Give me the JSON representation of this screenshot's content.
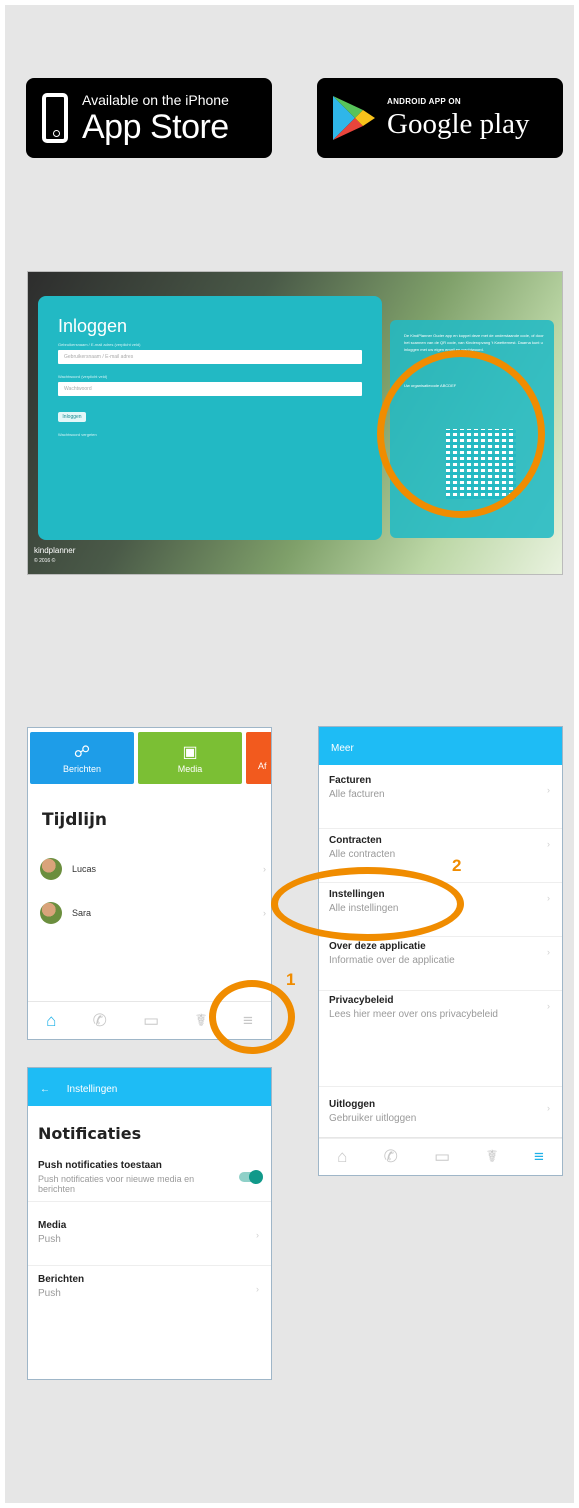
{
  "badges": {
    "apple": {
      "small": "Available on the iPhone",
      "big": "App Store"
    },
    "google": {
      "small": "ANDROID APP ON",
      "big": "Google play"
    }
  },
  "login": {
    "title": "Inloggen",
    "username_label": "Gebruikersnaam / E-mail adres (verplicht veld)",
    "username_placeholder": "Gebruikersnaam / E-mail adres",
    "password_label": "Wachtwoord (verplicht veld)",
    "password_placeholder": "Wachtwoord",
    "login_button": "Inloggen",
    "forgot": "Wachtwoord vergeten",
    "side_text": "De KindPlanner Ouder app en koppel deze met de onderstaande code, of door het scannen van de QR code, van Kinderopvang 't Kwetternest. Daarna kunt u inloggen met uw eigen email en wachtwoord.",
    "org_label": "Uw organisatiecode ABCDEF",
    "brand": "kindplanner",
    "copyright": "© 2016 ©"
  },
  "timeline": {
    "tiles": [
      {
        "label": "Berichten",
        "icon": "☍"
      },
      {
        "label": "Media",
        "icon": "▣"
      },
      {
        "label": "Af"
      }
    ],
    "heading": "Tijdlijn",
    "kids": [
      {
        "name": "Lucas"
      },
      {
        "name": "Sara"
      }
    ],
    "tab_icons": [
      "⌂",
      "✆",
      "▭",
      "☤",
      "≡"
    ]
  },
  "menu": {
    "header": "Meer",
    "items": [
      {
        "title": "Facturen",
        "subtitle": "Alle facturen"
      },
      {
        "title": "Contracten",
        "subtitle": "Alle contracten"
      },
      {
        "title": "Instellingen",
        "subtitle": "Alle instellingen"
      },
      {
        "title": "Over deze applicatie",
        "subtitle": "Informatie over de applicatie"
      },
      {
        "title": "Privacybeleid",
        "subtitle": "Lees hier meer over ons privacybeleid"
      },
      {
        "title": "Uitloggen",
        "subtitle": "Gebruiker uitloggen"
      }
    ],
    "tab_icons": [
      "⌂",
      "✆",
      "▭",
      "☤",
      "≡"
    ]
  },
  "settings": {
    "header": "Instellingen",
    "back_icon": "←",
    "heading": "Notificaties",
    "items": [
      {
        "title": "Push notificaties toestaan",
        "subtitle": "Push notificaties voor nieuwe media en berichten",
        "toggle": true
      },
      {
        "title": "Media",
        "subtitle": "Push"
      },
      {
        "title": "Berichten",
        "subtitle": "Push"
      }
    ]
  },
  "annotations": {
    "step1": "1",
    "step2": "2"
  },
  "colors": {
    "accent": "#f08c00",
    "app_blue": "#1ebcf5",
    "teal": "#22b9c4"
  }
}
